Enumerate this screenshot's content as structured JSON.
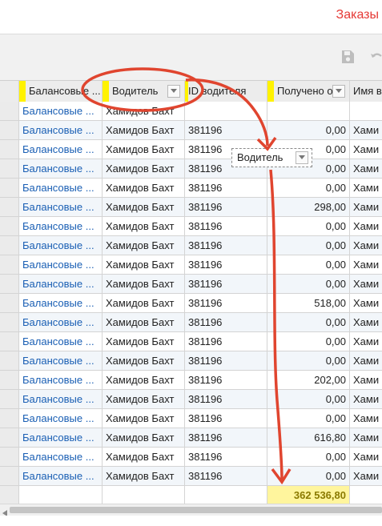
{
  "topbar": {
    "orders_link": "Заказы"
  },
  "toolbar": {
    "save_icon": "save-icon",
    "undo_icon": "undo-icon"
  },
  "grid": {
    "columns": [
      "Балансовые ...",
      "Водитель",
      "ID водителя",
      "Получено от",
      "Имя в"
    ],
    "rows": [
      {
        "balance": "Балансовые ...",
        "driver": "Хамидов Бахт",
        "driver_id": "",
        "received": "",
        "name": ""
      },
      {
        "balance": "Балансовые ...",
        "driver": "Хамидов Бахт",
        "driver_id": "381196",
        "received": "0,00",
        "name": "Хами"
      },
      {
        "balance": "Балансовые ...",
        "driver": "Хамидов Бахт",
        "driver_id": "381196",
        "received": "0,00",
        "name": "Хами"
      },
      {
        "balance": "Балансовые ...",
        "driver": "Хамидов Бахт",
        "driver_id": "381196",
        "received": "0,00",
        "name": "Хами"
      },
      {
        "balance": "Балансовые ...",
        "driver": "Хамидов Бахт",
        "driver_id": "381196",
        "received": "0,00",
        "name": "Хами"
      },
      {
        "balance": "Балансовые ...",
        "driver": "Хамидов Бахт",
        "driver_id": "381196",
        "received": "298,00",
        "name": "Хами"
      },
      {
        "balance": "Балансовые ...",
        "driver": "Хамидов Бахт",
        "driver_id": "381196",
        "received": "0,00",
        "name": "Хами"
      },
      {
        "balance": "Балансовые ...",
        "driver": "Хамидов Бахт",
        "driver_id": "381196",
        "received": "0,00",
        "name": "Хами"
      },
      {
        "balance": "Балансовые ...",
        "driver": "Хамидов Бахт",
        "driver_id": "381196",
        "received": "0,00",
        "name": "Хами"
      },
      {
        "balance": "Балансовые ...",
        "driver": "Хамидов Бахт",
        "driver_id": "381196",
        "received": "0,00",
        "name": "Хами"
      },
      {
        "balance": "Балансовые ...",
        "driver": "Хамидов Бахт",
        "driver_id": "381196",
        "received": "518,00",
        "name": "Хами"
      },
      {
        "balance": "Балансовые ...",
        "driver": "Хамидов Бахт",
        "driver_id": "381196",
        "received": "0,00",
        "name": "Хами"
      },
      {
        "balance": "Балансовые ...",
        "driver": "Хамидов Бахт",
        "driver_id": "381196",
        "received": "0,00",
        "name": "Хами"
      },
      {
        "balance": "Балансовые ...",
        "driver": "Хамидов Бахт",
        "driver_id": "381196",
        "received": "0,00",
        "name": "Хами"
      },
      {
        "balance": "Балансовые ...",
        "driver": "Хамидов Бахт",
        "driver_id": "381196",
        "received": "202,00",
        "name": "Хами"
      },
      {
        "balance": "Балансовые ...",
        "driver": "Хамидов Бахт",
        "driver_id": "381196",
        "received": "0,00",
        "name": "Хами"
      },
      {
        "balance": "Балансовые ...",
        "driver": "Хамидов Бахт",
        "driver_id": "381196",
        "received": "0,00",
        "name": "Хами"
      },
      {
        "balance": "Балансовые ...",
        "driver": "Хамидов Бахт",
        "driver_id": "381196",
        "received": "616,80",
        "name": "Хами"
      },
      {
        "balance": "Балансовые ...",
        "driver": "Хамидов Бахт",
        "driver_id": "381196",
        "received": "0,00",
        "name": "Хами"
      },
      {
        "balance": "Балансовые ...",
        "driver": "Хамидов Бахт",
        "driver_id": "381196",
        "received": "0,00",
        "name": "Хами"
      }
    ],
    "total": "362 536,80"
  },
  "drag_ghost": {
    "label": "Водитель"
  },
  "colors": {
    "accent": "#e53935",
    "link": "#1a5fb4",
    "highlight": "#fff200",
    "total_bg": "#fff59d"
  }
}
